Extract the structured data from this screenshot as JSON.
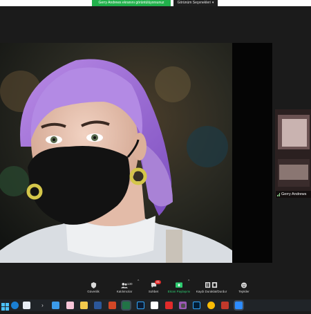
{
  "share_banner": {
    "text": "Gerry Andrews ekranını görüntülüyorsunuz"
  },
  "view_options": {
    "label": "Görünüm Seçenekleri"
  },
  "participant": {
    "name": "Gerry Andrews"
  },
  "controls": {
    "security": {
      "label": "Güvenlik",
      "icon": "shield-icon"
    },
    "participants": {
      "label": "Katılımcılar",
      "count": "130",
      "icon": "participants-icon"
    },
    "chat": {
      "label": "Sohbet",
      "badge": "41",
      "icon": "chat-icon"
    },
    "share": {
      "label": "Ekran Paylaşımı",
      "icon": "share-screen-icon"
    },
    "record": {
      "label": "Kaydı Duraklat/Durdur",
      "icon": "record-icon"
    },
    "reactions": {
      "label": "Tepkiler",
      "icon": "reactions-icon"
    }
  },
  "colors": {
    "accent_green": "#22b14c",
    "badge_red": "#e02b2b",
    "hair_purple": "#a56ad9"
  },
  "taskbar": {
    "icons": [
      "windows-start-icon",
      "edge-icon",
      "calendar-icon",
      "terminal-icon",
      "mail-icon",
      "photos-icon",
      "files-icon",
      "word-icon",
      "powerpoint-icon",
      "excel-icon",
      "lightroom-icon",
      "xd-icon",
      "acrobat-icon",
      "adobe-icon",
      "photoshop-icon",
      "chrome-icon",
      "camera-icon",
      "zoom-icon"
    ]
  }
}
